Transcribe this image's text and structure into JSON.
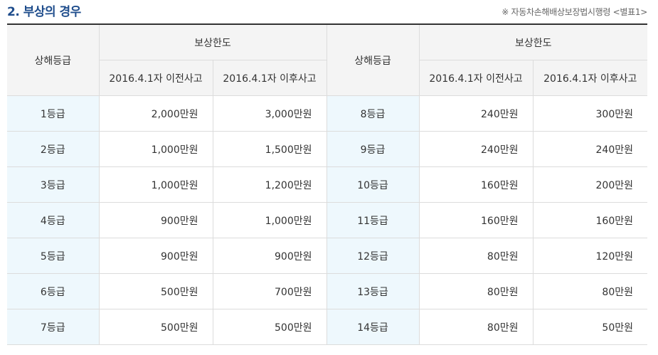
{
  "page": {
    "title": "2. 부상의 경우",
    "note": "※ 자동차손해배상보장법시행령 <별표1>"
  },
  "table": {
    "grade_header": "상해등급",
    "limit_header": "보상한도",
    "before_header": "2016.4.1자 이전사고",
    "after_header": "2016.4.1자 이후사고",
    "rows": [
      {
        "left": {
          "grade": "1등급",
          "before": "2,000만원",
          "after": "3,000만원"
        },
        "right": {
          "grade": "8등급",
          "before": "240만원",
          "after": "300만원"
        }
      },
      {
        "left": {
          "grade": "2등급",
          "before": "1,000만원",
          "after": "1,500만원"
        },
        "right": {
          "grade": "9등급",
          "before": "240만원",
          "after": "240만원"
        }
      },
      {
        "left": {
          "grade": "3등급",
          "before": "1,000만원",
          "after": "1,200만원"
        },
        "right": {
          "grade": "10등급",
          "before": "160만원",
          "after": "200만원"
        }
      },
      {
        "left": {
          "grade": "4등급",
          "before": "900만원",
          "after": "1,000만원"
        },
        "right": {
          "grade": "11등급",
          "before": "160만원",
          "after": "160만원"
        }
      },
      {
        "left": {
          "grade": "5등급",
          "before": "900만원",
          "after": "900만원"
        },
        "right": {
          "grade": "12등급",
          "before": "80만원",
          "after": "120만원"
        }
      },
      {
        "left": {
          "grade": "6등급",
          "before": "500만원",
          "after": "700만원"
        },
        "right": {
          "grade": "13등급",
          "before": "80만원",
          "after": "80만원"
        }
      },
      {
        "left": {
          "grade": "7등급",
          "before": "500만원",
          "after": "500만원"
        },
        "right": {
          "grade": "14등급",
          "before": "80만원",
          "after": "50만원"
        }
      }
    ]
  }
}
